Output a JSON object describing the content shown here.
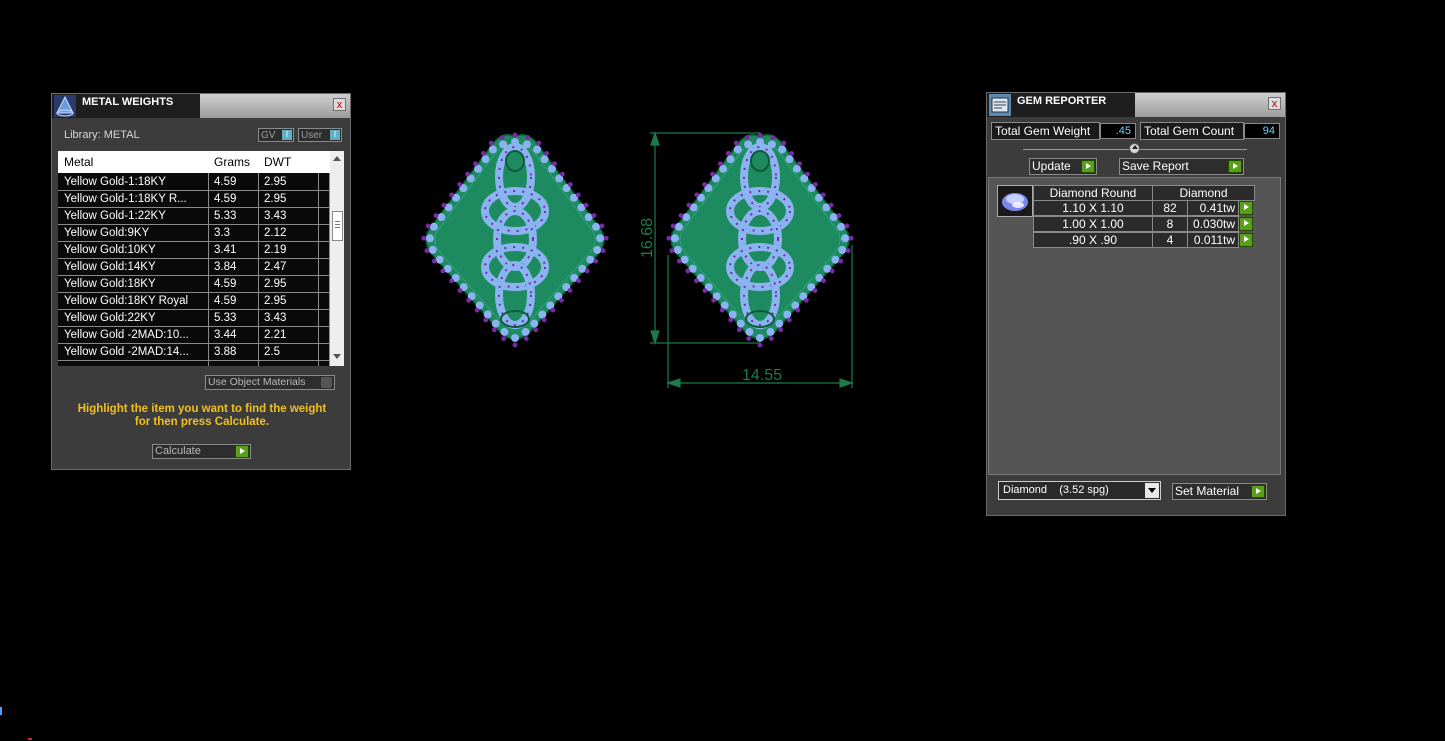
{
  "metal_weights": {
    "title": "METAL WEIGHTS",
    "close_label": "x",
    "library_label": "Library: METAL",
    "toggle_gv": "GV",
    "toggle_user": "User",
    "columns": [
      "Metal",
      "Grams",
      "DWT"
    ],
    "rows": [
      {
        "metal": "Yellow Gold-1:18KY",
        "grams": "4.59",
        "dwt": "2.95"
      },
      {
        "metal": "Yellow Gold-1:18KY R...",
        "grams": "4.59",
        "dwt": "2.95"
      },
      {
        "metal": "Yellow Gold-1:22KY",
        "grams": "5.33",
        "dwt": "3.43"
      },
      {
        "metal": "Yellow Gold:9KY",
        "grams": "3.3",
        "dwt": "2.12"
      },
      {
        "metal": "Yellow Gold:10KY",
        "grams": "3.41",
        "dwt": "2.19"
      },
      {
        "metal": "Yellow Gold:14KY",
        "grams": "3.84",
        "dwt": "2.47"
      },
      {
        "metal": "Yellow Gold:18KY",
        "grams": "4.59",
        "dwt": "2.95"
      },
      {
        "metal": "Yellow Gold:18KY Royal",
        "grams": "4.59",
        "dwt": "2.95"
      },
      {
        "metal": "Yellow Gold:22KY",
        "grams": "5.33",
        "dwt": "3.43"
      },
      {
        "metal": "Yellow Gold -2MAD:10...",
        "grams": "3.44",
        "dwt": "2.21"
      },
      {
        "metal": "Yellow Gold -2MAD:14...",
        "grams": "3.88",
        "dwt": "2.5"
      }
    ],
    "use_object_materials": "Use Object Materials",
    "instruction": "Highlight the item you want to find the weight for then press Calculate.",
    "calculate_label": "Calculate"
  },
  "drawing": {
    "dim_height": "16.68",
    "dim_width": "14.55",
    "colors": {
      "metal": "#1e8a60",
      "gem": "#8ab4f0",
      "prong": "#7a2aa8",
      "dimension": "#1a7a4a"
    }
  },
  "gem_reporter": {
    "title": "GEM REPORTER",
    "close_label": "x",
    "total_weight_label": "Total Gem Weight",
    "total_weight_value": ".45",
    "total_count_label": "Total Gem Count",
    "total_count_value": "94",
    "update_label": "Update",
    "save_report_label": "Save Report",
    "table_header": {
      "shape": "Diamond Round",
      "material": "Diamond"
    },
    "rows": [
      {
        "size": "1.10 X 1.10",
        "count": "82",
        "weight": "0.41tw"
      },
      {
        "size": "1.00 X 1.00",
        "count": "8",
        "weight": "0.030tw"
      },
      {
        "size": ".90 X .90",
        "count": "4",
        "weight": "0.011tw"
      }
    ],
    "material_select": "Diamond    (3.52 spg)",
    "set_material_label": "Set Material"
  }
}
